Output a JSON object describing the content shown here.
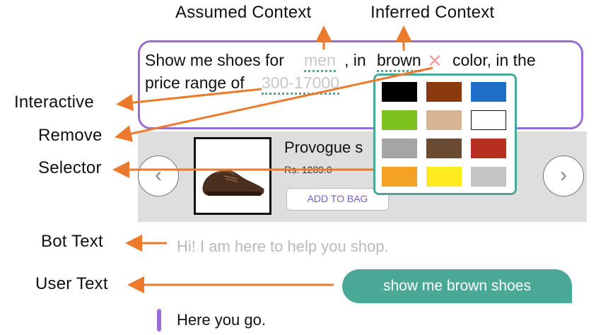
{
  "annotations": {
    "assumed_context": "Assumed Context",
    "inferred_context": "Inferred Context",
    "interactive": "Interactive",
    "remove": "Remove",
    "selector": "Selector",
    "bot_text": "Bot Text",
    "user_text": "User Text"
  },
  "query": {
    "part1": "Show me shoes for",
    "gender": "men",
    "part2": ", in",
    "color": "brown",
    "remove_glyph": "✕",
    "part3": "color, in the",
    "part4": "price range of",
    "price_range": "300-17000"
  },
  "product": {
    "title": "Provogue s",
    "price": "Rs. 1289.0",
    "add_to_bag": "ADD TO BAG",
    "prev_icon": "chevron-left-icon",
    "next_icon": "chevron-right-icon"
  },
  "color_swatches": [
    {
      "name": "black",
      "hex": "#000000"
    },
    {
      "name": "brown",
      "hex": "#8b3a0f"
    },
    {
      "name": "blue",
      "hex": "#1f6fc9"
    },
    {
      "name": "green",
      "hex": "#7dc21f"
    },
    {
      "name": "tan",
      "hex": "#d6b594"
    },
    {
      "name": "white",
      "hex": "#ffffff"
    },
    {
      "name": "grey",
      "hex": "#a5a5a5"
    },
    {
      "name": "dark-brown",
      "hex": "#6b4a32"
    },
    {
      "name": "red",
      "hex": "#b7301f"
    },
    {
      "name": "orange",
      "hex": "#f3a224"
    },
    {
      "name": "yellow",
      "hex": "#ffeb1f"
    },
    {
      "name": "light-grey",
      "hex": "#c4c4c4"
    }
  ],
  "chat": {
    "bot_message": "Hi! I am here to help you shop.",
    "user_message": "show me brown shoes",
    "bot_reply": "Here you go."
  },
  "colors": {
    "accent_purple": "#9a6cd6",
    "accent_teal": "#4aa896",
    "arrow_orange": "#ec7a2d"
  }
}
